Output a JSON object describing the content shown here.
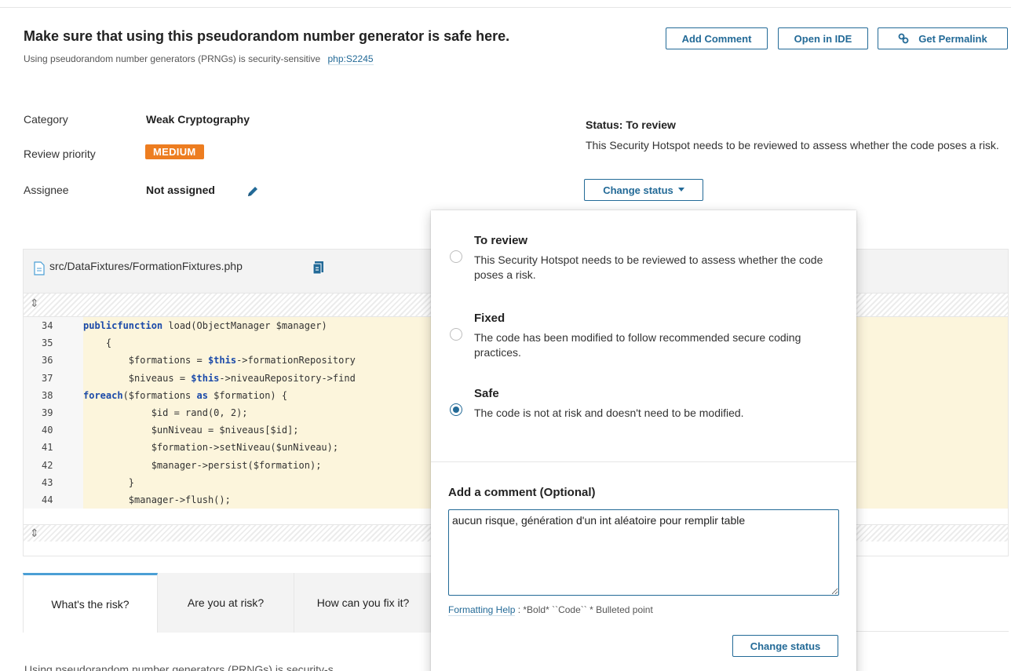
{
  "hotspot": {
    "title": "Make sure that using this pseudorandom number generator is safe here.",
    "subtitle": "Using pseudorandom number generators (PRNGs) is security-sensitive",
    "rule_key": "php:S2245"
  },
  "actions": {
    "add_comment": "Add Comment",
    "open_in_ide": "Open in IDE",
    "get_permalink": "Get Permalink"
  },
  "meta": {
    "category_label": "Category",
    "category_value": "Weak Cryptography",
    "priority_label": "Review priority",
    "priority_value": "MEDIUM",
    "assignee_label": "Assignee",
    "assignee_value": "Not assigned"
  },
  "status": {
    "title": "Status: To review",
    "description": "This Security Hotspot needs to be reviewed to assess whether the code poses a risk.",
    "change_button": "Change status"
  },
  "code": {
    "file_path": "src/DataFixtures/FormationFixtures.php",
    "lines": [
      {
        "num": "34",
        "text": "    public function load(ObjectManager $manager)"
      },
      {
        "num": "35",
        "text": "    {"
      },
      {
        "num": "36",
        "text": "        $formations = $this->formationRepository"
      },
      {
        "num": "37",
        "text": "        $niveaus = $this->niveauRepository->find"
      },
      {
        "num": "38",
        "text": "        foreach($formations as $formation) {"
      },
      {
        "num": "39",
        "text": "            $id = rand(0, 2);"
      },
      {
        "num": "40",
        "text": "            $unNiveau = $niveaus[$id];"
      },
      {
        "num": "41",
        "text": "            $formation->setNiveau($unNiveau);"
      },
      {
        "num": "42",
        "text": "            $manager->persist($formation);"
      },
      {
        "num": "43",
        "text": "        }"
      },
      {
        "num": "44",
        "text": "        $manager->flush();"
      }
    ]
  },
  "tabs": [
    {
      "label": "What's the risk?"
    },
    {
      "label": "Are you at risk?"
    },
    {
      "label": "How can you fix it?"
    }
  ],
  "bottom_text": "Using pseudorandom number generators (PRNGs) is security-s",
  "popup": {
    "options": [
      {
        "title": "To review",
        "description": "This Security Hotspot needs to be reviewed to assess whether the code poses a risk.",
        "selected": false
      },
      {
        "title": "Fixed",
        "description": "The code has been modified to follow recommended secure coding practices.",
        "selected": false
      },
      {
        "title": "Safe",
        "description": "The code is not at risk and doesn't need to be modified.",
        "selected": true
      }
    ],
    "comment_label": "Add a comment (Optional)",
    "comment_value": "aucun risque, génération d'un int aléatoire pour remplir table",
    "formatting_help": "Formatting Help",
    "formatting_hints": ":  *Bold*  ``Code``  * Bulleted point",
    "submit_button": "Change status"
  },
  "colors": {
    "accent": "#236a97",
    "priority_medium": "#ed7d20",
    "code_highlight": "#fcf5dc"
  },
  "icons": [
    "link-icon",
    "pencil-icon",
    "file-icon",
    "copy-path-icon",
    "expand-icon",
    "caret-down-icon"
  ]
}
